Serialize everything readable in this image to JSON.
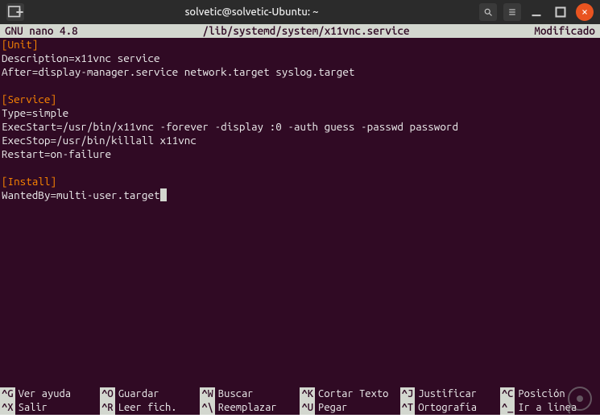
{
  "titlebar": {
    "title": "solvetic@solvetic-Ubuntu: ~"
  },
  "nano": {
    "version": "GNU nano 4.8",
    "file": "/lib/systemd/system/x11vnc.service",
    "status": "Modificado"
  },
  "file_content": {
    "sections": [
      {
        "header": "[Unit]",
        "lines": [
          "Description=x11vnc service",
          "After=display-manager.service network.target syslog.target"
        ]
      },
      {
        "header": "[Service]",
        "lines": [
          "Type=simple",
          "ExecStart=/usr/bin/x11vnc -forever -display :0 -auth guess -passwd password",
          "ExecStop=/usr/bin/killall x11vnc",
          "Restart=on-failure"
        ]
      },
      {
        "header": "[Install]",
        "lines": [
          "WantedBy=multi-user.target"
        ]
      }
    ]
  },
  "shortcuts": {
    "row1": [
      {
        "key": "^G",
        "label": "Ver ayuda"
      },
      {
        "key": "^O",
        "label": "Guardar"
      },
      {
        "key": "^W",
        "label": "Buscar"
      },
      {
        "key": "^K",
        "label": "Cortar Texto"
      },
      {
        "key": "^J",
        "label": "Justificar"
      },
      {
        "key": "^C",
        "label": "Posición"
      }
    ],
    "row2": [
      {
        "key": "^X",
        "label": "Salir"
      },
      {
        "key": "^R",
        "label": "Leer fich."
      },
      {
        "key": "^\\",
        "label": "Reemplazar"
      },
      {
        "key": "^U",
        "label": "Pegar"
      },
      {
        "key": "^T",
        "label": "Ortografía"
      },
      {
        "key": "^_",
        "label": "Ir a línea"
      }
    ]
  }
}
